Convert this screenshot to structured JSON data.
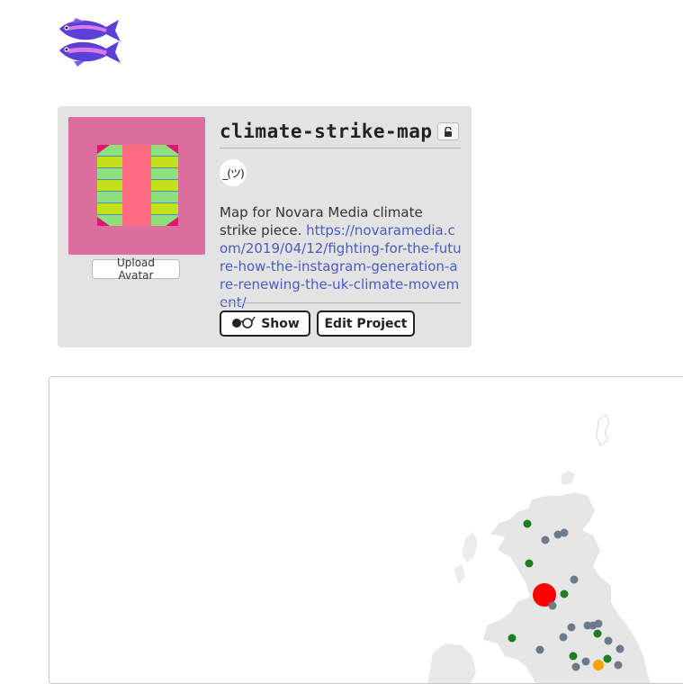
{
  "app": {
    "logo_icon": "fish-logo-icon"
  },
  "project": {
    "name": "climate-strike-map",
    "lock_icon": "padlock-icon",
    "user_avatar_text": "_(ツ)",
    "description_text": "Map for Novara Media climate strike piece.",
    "description_link": "https://novaramedia.com/2019/04/12/fighting-for-the-future-how-the-instagram-generation-are-renewing-the-uk-climate-movement/",
    "upload_avatar_label": "Upload Avatar",
    "show_label": "Show",
    "show_icon": "glasses-icon",
    "edit_label": "Edit Project",
    "avatar_colors": {
      "background": "#dc6d9f",
      "stripe_green": "#8de07b",
      "stripe_lime": "#c4e01a",
      "center": "#ff6b80",
      "edge": "#4f8fc4"
    }
  },
  "map": {
    "land_color": "#e6e6e6",
    "marker_colors": {
      "large": "#ff0000",
      "green": "#1e7d23",
      "grey": "#6c7b8a",
      "orange": "#f5a400"
    }
  }
}
